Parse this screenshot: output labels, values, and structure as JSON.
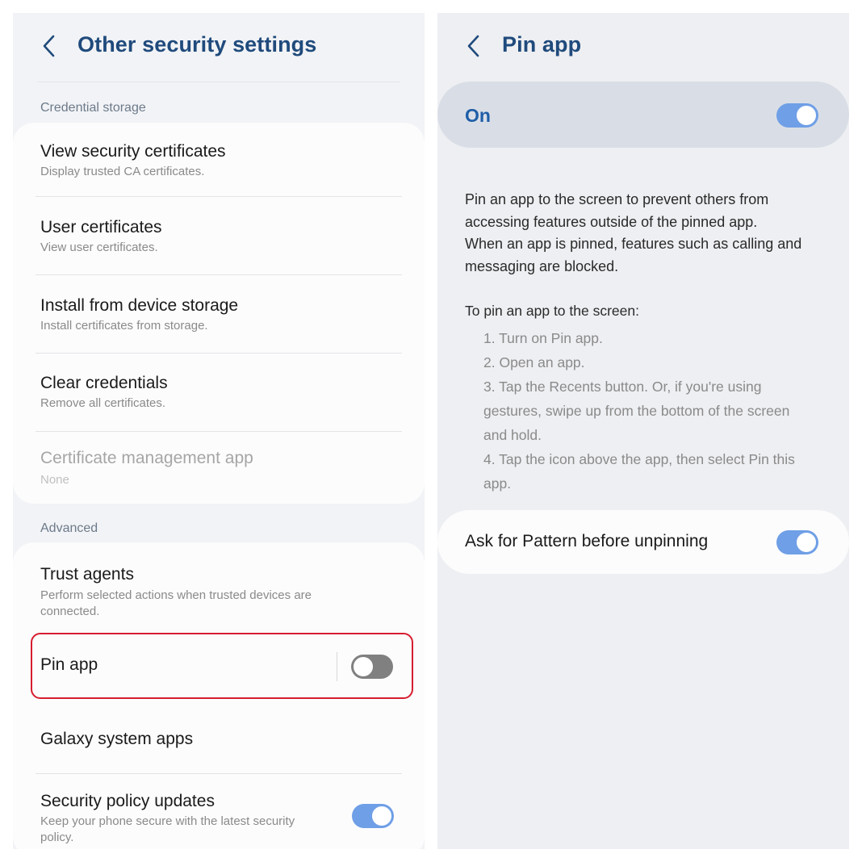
{
  "left": {
    "title": "Other security settings",
    "section_credential": "Credential storage",
    "section_advanced": "Advanced",
    "credential_items": [
      {
        "title": "View security certificates",
        "subtitle": "Display trusted CA certificates."
      },
      {
        "title": "User certificates",
        "subtitle": "View user certificates."
      },
      {
        "title": "Install from device storage",
        "subtitle": "Install certificates from storage."
      },
      {
        "title": "Clear credentials",
        "subtitle": "Remove all certificates."
      },
      {
        "title": "Certificate management app",
        "subtitle": "None"
      }
    ],
    "advanced_items": {
      "trust_agents": {
        "title": "Trust agents",
        "subtitle_line1": "Perform selected actions when trusted devices are",
        "subtitle_line2": "connected."
      },
      "pin_app": {
        "title": "Pin app",
        "toggle": "off"
      },
      "galaxy_system_apps": {
        "title": "Galaxy system apps"
      },
      "security_policy_updates": {
        "title": "Security policy updates",
        "subtitle_line1": "Keep your phone secure with the latest security",
        "subtitle_line2": "policy.",
        "toggle": "on"
      }
    }
  },
  "right": {
    "title": "Pin app",
    "master_switch": {
      "label": "On",
      "toggle": "on"
    },
    "description_lines": [
      "Pin an app to the screen to prevent others from",
      "accessing features outside of the pinned app.",
      "When an app is pinned, features such as calling and",
      "messaging are blocked."
    ],
    "howto_title": "To pin an app to the screen:",
    "steps": [
      "1. Turn on Pin app.",
      "2. Open an app.",
      "3. Tap the Recents button. Or, if you're using",
      "gestures, swipe up from the bottom of the screen",
      "and hold.",
      "4. Tap the icon above the app, then select Pin this",
      "app."
    ],
    "ask_pattern": {
      "label": "Ask for Pattern before unpinning",
      "toggle": "on"
    }
  },
  "colors": {
    "accent": "#6f9fe6",
    "header_text": "#1f4a7c",
    "highlight": "#d61d2e",
    "toggle_off": "#808080"
  }
}
